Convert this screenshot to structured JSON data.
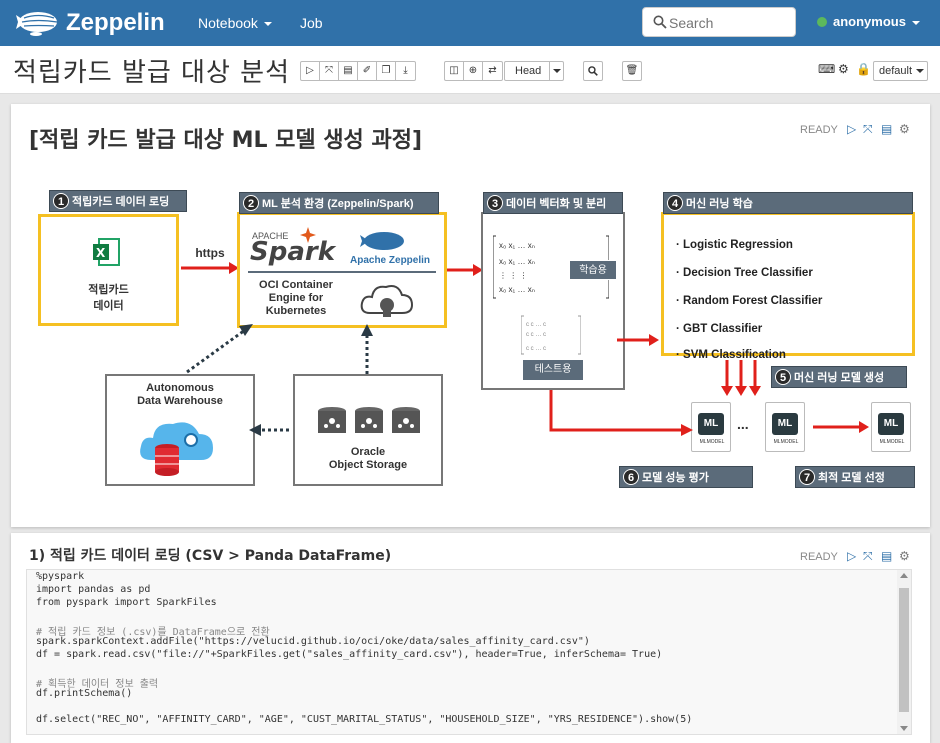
{
  "navbar": {
    "brand": "Zeppelin",
    "menu_notebook": "Notebook",
    "menu_job": "Job",
    "search_placeholder": "Search",
    "user": "anonymous"
  },
  "notebook": {
    "title": "적립카드 발급 대상 분석",
    "head_select": "Head",
    "interpreter_binding": "default"
  },
  "paragraph1": {
    "title": "[적립 카드 발급 대상 ML 모델 생성 과정]",
    "status": "READY",
    "diagram": {
      "step1": {
        "label": "적립카드 데이터 로딩",
        "num": "1",
        "content": "적립카드\n데이터"
      },
      "https": "https",
      "step2": {
        "label": "ML 분석 환경 (Zeppelin/Spark)",
        "num": "2",
        "spark": "Spark",
        "apache": "APACHE",
        "zeppelin": "Apache Zeppelin",
        "oci": "OCI Container\nEngine for\nKubernetes"
      },
      "step3": {
        "label": "데이터 벡터화 및 분리",
        "num": "3",
        "train": "학습용",
        "test": "테스트용"
      },
      "step4": {
        "label": "머신 러닝 학습",
        "num": "4",
        "items": [
          "Logistic Regression",
          "Decision Tree Classifier",
          "Random Forest Classifier",
          "GBT Classifier",
          "SVM Classification"
        ]
      },
      "step5": {
        "label": "머신 러닝 모델 생성",
        "num": "5"
      },
      "step6": {
        "label": "모델 성능 평가",
        "num": "6"
      },
      "step7": {
        "label": "최적 모델 선정",
        "num": "7"
      },
      "adw": "Autonomous\nData Warehouse",
      "oos": "Oracle\nObject Storage",
      "ml_label": "ML",
      "mlmodel": "MLMODEL",
      "dots": "..."
    }
  },
  "paragraph2": {
    "title": "1) 적립 카드 데이터 로딩 (CSV > Panda DataFrame)",
    "status": "READY",
    "code": [
      "%pyspark",
      "import pandas as pd",
      "from pyspark import SparkFiles",
      "",
      "# 적립 카드 정보 (.csv)를 DataFrame으로 전환",
      "spark.sparkContext.addFile(\"https://velucid.github.io/oci/oke/data/sales_affinity_card.csv\")",
      "df = spark.read.csv(\"file://\"+SparkFiles.get(\"sales_affinity_card.csv\"), header=True, inferSchema= True)",
      "",
      "# 획득한 데이터 정보 출력",
      "df.printSchema()",
      "",
      "df.select(\"REC_NO\", \"AFFINITY_CARD\", \"AGE\", \"CUST_MARITAL_STATUS\", \"HOUSEHOLD_SIZE\", \"YRS_RESIDENCE\").show(5)"
    ]
  },
  "colors": {
    "navbar": "#3071a9",
    "accent": "#f5c022",
    "step_header": "#5b6b7a",
    "arrow": "#e0201b"
  }
}
